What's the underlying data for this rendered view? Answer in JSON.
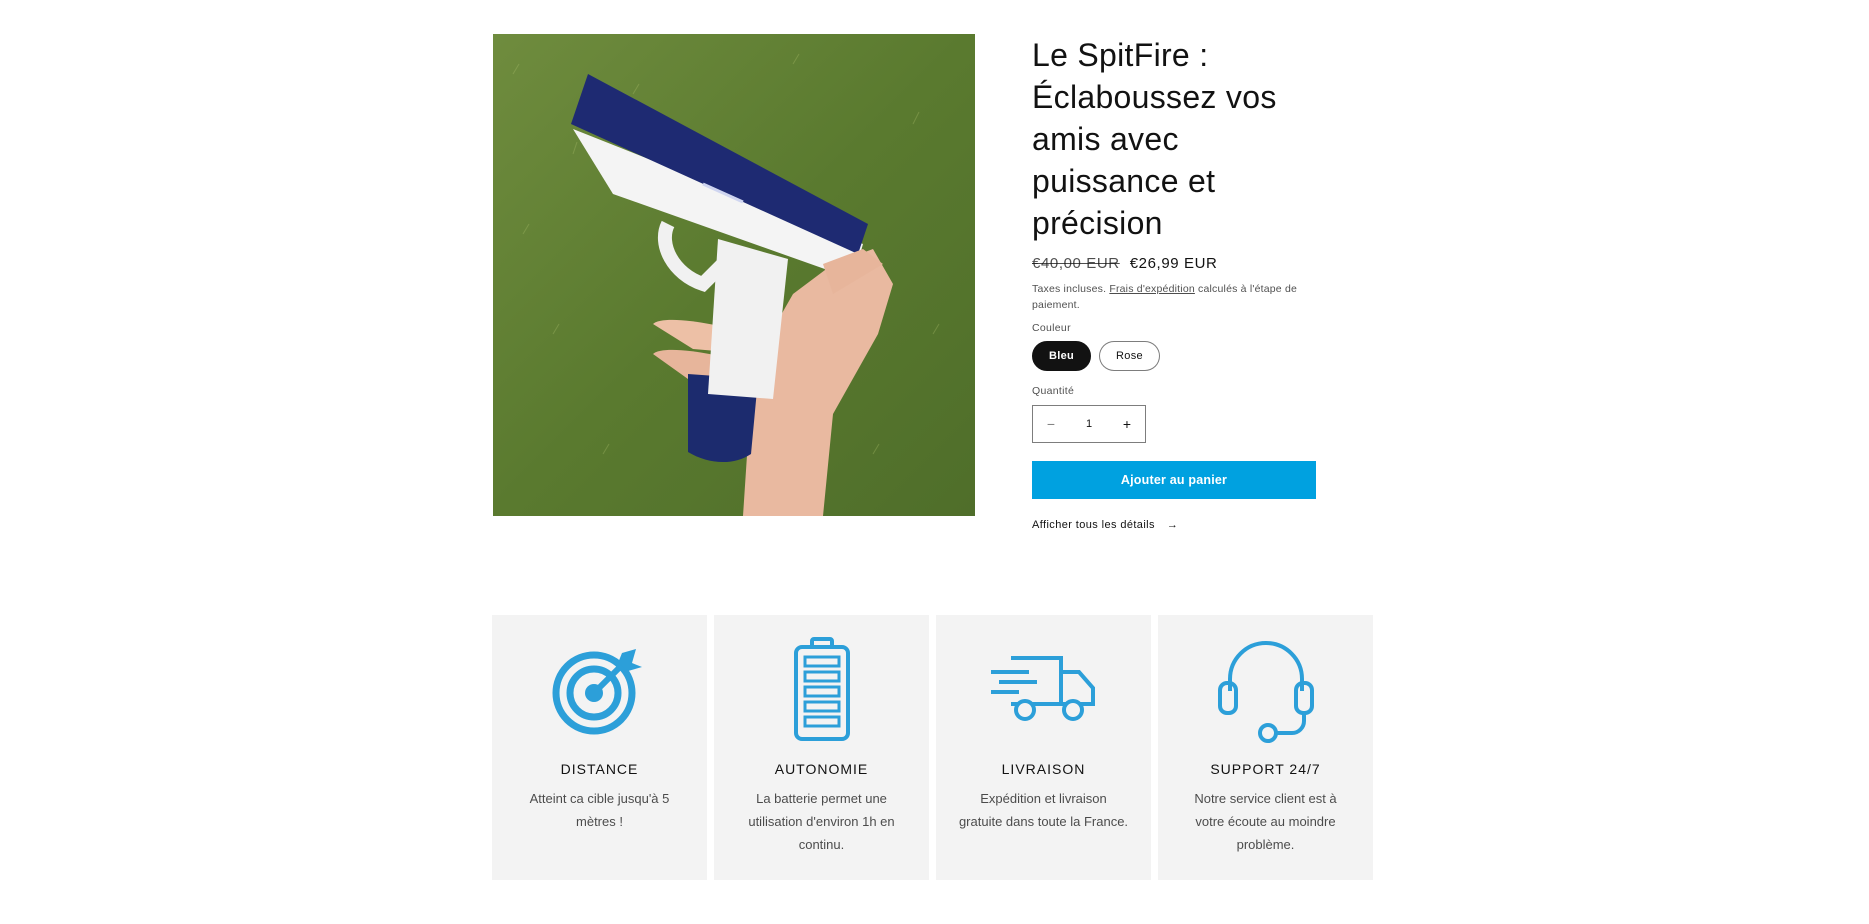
{
  "product": {
    "title": "Le SpitFire : Éclaboussez vos amis avec puissance et précision",
    "price_compare": "€40,00 EUR",
    "price_sale": "€26,99 EUR",
    "tax_prefix": "Taxes incluses. ",
    "tax_link": "Frais d'expédition",
    "tax_suffix": " calculés à l'étape de paiement.",
    "color_label": "Couleur",
    "colors": [
      "Bleu",
      "Rose"
    ],
    "selected_color": "Bleu",
    "quantity_label": "Quantité",
    "quantity_value": "1",
    "quantity_minus": "−",
    "quantity_plus": "+",
    "add_to_cart": "Ajouter au panier",
    "view_details": "Afficher tous les détails",
    "view_details_arrow": "→"
  },
  "features": [
    {
      "icon": "target-icon",
      "title": "DISTANCE",
      "text": "Atteint ca cible jusqu'à 5 mètres !"
    },
    {
      "icon": "battery-icon",
      "title": "AUTONOMIE",
      "text": "La batterie permet une utilisation d'environ 1h en continu."
    },
    {
      "icon": "delivery-truck-icon",
      "title": "LIVRAISON",
      "text": "Expédition et livraison gratuite dans toute la France."
    },
    {
      "icon": "headset-icon",
      "title": "SUPPORT 24/7",
      "text": "Notre service client est à votre écoute au moindre problème."
    }
  ],
  "colors": {
    "accent": "#00a1e0",
    "icon": "#2c9fd9",
    "dark": "#121212"
  }
}
